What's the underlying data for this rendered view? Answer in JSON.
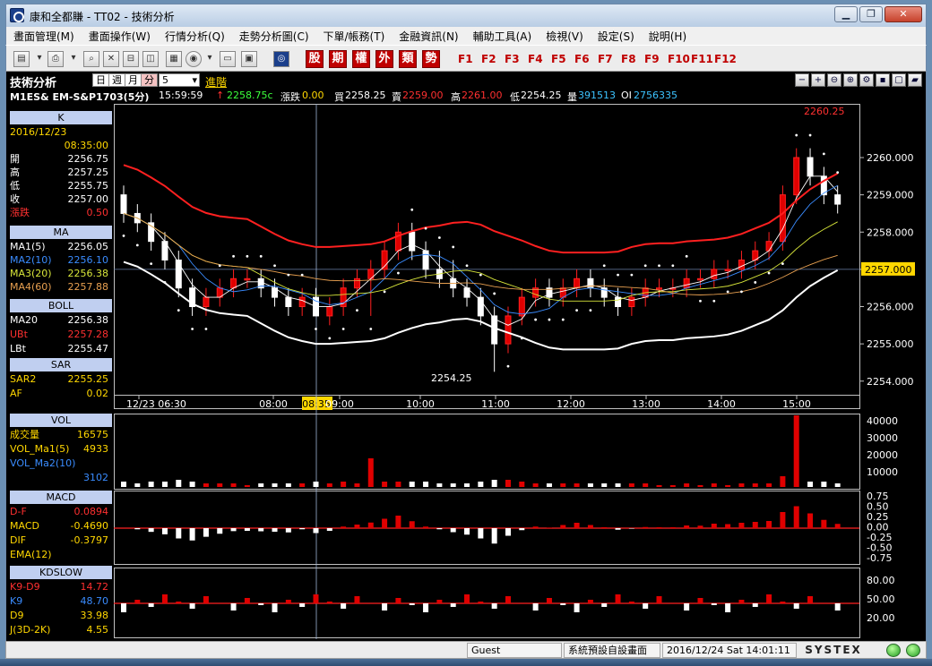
{
  "window": {
    "title": "康和全都賺 - TT02 - 技術分析",
    "min_icon": "minimize-icon",
    "max_icon": "maximize-icon",
    "close_icon": "close-icon"
  },
  "menu": [
    "畫面管理(M)",
    "畫面操作(W)",
    "行情分析(Q)",
    "走勢分析圖(C)",
    "下單/帳務(T)",
    "金融資訊(N)",
    "輔助工具(A)",
    "檢視(V)",
    "設定(S)",
    "說明(H)"
  ],
  "toolbar": {
    "red_buttons": [
      "股",
      "期",
      "權",
      "外",
      "類",
      "勢"
    ],
    "fkeys": [
      "F1",
      "F2",
      "F3",
      "F4",
      "F5",
      "F6",
      "F7",
      "F8",
      "F9",
      "F10",
      "F11",
      "F12"
    ]
  },
  "chart_header": {
    "title": "技術分析",
    "periods": [
      "日",
      "週",
      "月",
      "分"
    ],
    "selected_period": "分",
    "interval": "5",
    "advanced": "進階"
  },
  "quote": {
    "symbol": "M1ES&  EM-S&P1703(5分)",
    "time": "15:59:59",
    "arrow": "↑",
    "last": "2258.75c",
    "change_label": "漲跌",
    "change": "0.00",
    "bid_label": "買",
    "bid": "2258.25",
    "ask_label": "賣",
    "ask": "2259.00",
    "high_label": "高",
    "high": "2261.00",
    "low_label": "低",
    "low": "2254.25",
    "vol_label": "量",
    "vol": "391513",
    "oi_label": "OI",
    "oi": "2756335"
  },
  "panel": {
    "k": {
      "head": "K",
      "date": "2016/12/23",
      "time": "08:35:00",
      "rows": [
        {
          "label": "開",
          "value": "2256.75",
          "color": "#ffffff"
        },
        {
          "label": "高",
          "value": "2257.25",
          "color": "#ffffff"
        },
        {
          "label": "低",
          "value": "2255.75",
          "color": "#ffffff"
        },
        {
          "label": "收",
          "value": "2257.00",
          "color": "#ffffff"
        },
        {
          "label": "漲跌",
          "value": "0.50",
          "color": "#ff3030"
        }
      ]
    },
    "ma": {
      "head": "MA",
      "rows": [
        {
          "label": "MA1(5)",
          "value": "2256.05",
          "color": "#ffffff"
        },
        {
          "label": "MA2(10)",
          "value": "2256.10",
          "color": "#3a8cff"
        },
        {
          "label": "MA3(20)",
          "value": "2256.38",
          "color": "#d8e63a"
        },
        {
          "label": "MA4(60)",
          "value": "2257.88",
          "color": "#e8a050"
        }
      ]
    },
    "boll": {
      "head": "BOLL",
      "rows": [
        {
          "label": "MA20",
          "value": "2256.38",
          "color": "#ffffff"
        },
        {
          "label": "UBt",
          "value": "2257.28",
          "color": "#ff3030"
        },
        {
          "label": "LBt",
          "value": "2255.47",
          "color": "#ffffff"
        }
      ]
    },
    "sar": {
      "head": "SAR",
      "rows": [
        {
          "label": "SAR2",
          "value": "2255.25",
          "color": "#ffd700"
        },
        {
          "label": "AF",
          "value": "0.02",
          "color": "#ffd700"
        }
      ]
    },
    "vol": {
      "head": "VOL",
      "rows": [
        {
          "label": "成交量",
          "value": "16575",
          "color": "#ffd700"
        },
        {
          "label": "VOL_Ma1(5)",
          "value": "4933",
          "color": "#ffd700"
        },
        {
          "label": "VOL_Ma2(10)",
          "value": "",
          "color": "#3a8cff"
        },
        {
          "label": "",
          "value": "3102",
          "color": "#3a8cff"
        }
      ]
    },
    "macd": {
      "head": "MACD",
      "rows": [
        {
          "label": "D-F",
          "value": "0.0894",
          "color": "#ff3030"
        },
        {
          "label": "MACD",
          "value": "-0.4690",
          "color": "#ffd700"
        },
        {
          "label": "DIF",
          "value": "-0.3797",
          "color": "#ffd700"
        },
        {
          "label": "EMA(12)",
          "value": "",
          "color": "#ffd700"
        }
      ]
    },
    "kd": {
      "head": "KDSLOW",
      "rows": [
        {
          "label": "K9-D9",
          "value": "14.72",
          "color": "#ff3030"
        },
        {
          "label": "K9",
          "value": "48.70",
          "color": "#3a8cff"
        },
        {
          "label": "D9",
          "value": "33.98",
          "color": "#ffd700"
        },
        {
          "label": "J(3D-2K)",
          "value": "4.55",
          "color": "#ffd700"
        }
      ]
    }
  },
  "chart_data": {
    "type": "candlestick",
    "price_axis": {
      "ticks": [
        "2260.000",
        "2259.000",
        "2258.000",
        "2257.000",
        "2256.000",
        "2255.000",
        "2254.000"
      ],
      "ylim": [
        2253.85,
        2261.25
      ]
    },
    "time_axis": {
      "ticks": [
        "12/23 06:30",
        "08:00",
        "08:35",
        "09:00",
        "10:00",
        "11:00",
        "12:00",
        "13:00",
        "14:00",
        "15:00"
      ]
    },
    "last_price_marker": "2257.000",
    "cursor_time": "08:35",
    "annotations": {
      "high": "2260.25",
      "low": "2254.25"
    },
    "candles": [
      [
        2259.0,
        2259.25,
        2258.25,
        2258.5
      ],
      [
        2258.5,
        2258.75,
        2258.0,
        2258.25
      ],
      [
        2258.25,
        2258.5,
        2257.5,
        2257.75
      ],
      [
        2257.75,
        2258.0,
        2257.0,
        2257.25
      ],
      [
        2257.25,
        2257.5,
        2256.25,
        2256.5
      ],
      [
        2256.5,
        2256.75,
        2255.75,
        2256.0
      ],
      [
        2256.0,
        2256.5,
        2255.75,
        2256.25
      ],
      [
        2256.25,
        2256.75,
        2256.0,
        2256.5
      ],
      [
        2256.5,
        2257.0,
        2256.25,
        2256.75
      ],
      [
        2256.75,
        2257.0,
        2256.5,
        2256.75
      ],
      [
        2256.75,
        2257.0,
        2256.25,
        2256.5
      ],
      [
        2256.5,
        2256.75,
        2256.0,
        2256.25
      ],
      [
        2256.25,
        2256.5,
        2255.75,
        2256.0
      ],
      [
        2256.0,
        2256.5,
        2255.75,
        2256.25
      ],
      [
        2256.25,
        2256.5,
        2255.75,
        2255.75
      ],
      [
        2255.75,
        2256.25,
        2255.5,
        2256.0
      ],
      [
        2256.0,
        2256.75,
        2255.75,
        2256.5
      ],
      [
        2256.5,
        2257.0,
        2256.25,
        2256.75
      ],
      [
        2256.75,
        2257.25,
        2255.75,
        2257.0
      ],
      [
        2257.0,
        2257.75,
        2256.75,
        2257.5
      ],
      [
        2257.5,
        2258.25,
        2257.25,
        2258.0
      ],
      [
        2258.0,
        2258.25,
        2257.25,
        2257.5
      ],
      [
        2257.5,
        2257.75,
        2256.75,
        2257.0
      ],
      [
        2257.0,
        2257.5,
        2256.5,
        2256.75
      ],
      [
        2256.75,
        2257.25,
        2256.25,
        2256.5
      ],
      [
        2256.5,
        2256.75,
        2256.0,
        2256.25
      ],
      [
        2256.25,
        2256.5,
        2255.5,
        2255.75
      ],
      [
        2255.75,
        2256.0,
        2254.25,
        2255.0
      ],
      [
        2255.0,
        2256.0,
        2254.75,
        2255.75
      ],
      [
        2255.75,
        2256.5,
        2255.5,
        2256.25
      ],
      [
        2256.25,
        2256.75,
        2256.0,
        2256.5
      ],
      [
        2256.5,
        2256.75,
        2256.0,
        2256.25
      ],
      [
        2256.25,
        2256.75,
        2256.0,
        2256.5
      ],
      [
        2256.5,
        2257.0,
        2256.25,
        2256.75
      ],
      [
        2256.75,
        2257.0,
        2256.25,
        2256.5
      ],
      [
        2256.5,
        2256.75,
        2256.0,
        2256.25
      ],
      [
        2256.25,
        2256.5,
        2255.75,
        2256.0
      ],
      [
        2256.0,
        2256.5,
        2255.75,
        2256.25
      ],
      [
        2256.25,
        2256.75,
        2256.0,
        2256.5
      ],
      [
        2256.5,
        2256.75,
        2256.25,
        2256.5
      ],
      [
        2256.5,
        2256.75,
        2256.25,
        2256.5
      ],
      [
        2256.5,
        2257.0,
        2256.25,
        2256.75
      ],
      [
        2256.75,
        2257.0,
        2256.5,
        2256.75
      ],
      [
        2256.75,
        2257.25,
        2256.5,
        2257.0
      ],
      [
        2257.0,
        2257.25,
        2256.75,
        2257.0
      ],
      [
        2257.0,
        2257.5,
        2256.75,
        2257.25
      ],
      [
        2257.25,
        2257.75,
        2257.0,
        2257.5
      ],
      [
        2257.5,
        2258.0,
        2257.25,
        2257.75
      ],
      [
        2257.75,
        2259.25,
        2257.5,
        2259.0
      ],
      [
        2259.0,
        2260.25,
        2258.75,
        2260.0
      ],
      [
        2260.0,
        2260.25,
        2259.25,
        2259.5
      ],
      [
        2259.5,
        2259.75,
        2258.75,
        2259.0
      ],
      [
        2259.0,
        2259.25,
        2258.5,
        2258.75
      ]
    ],
    "volume_axis": {
      "ticks": [
        "40000",
        "30000",
        "20000",
        "10000"
      ]
    },
    "macd_axis": {
      "ticks": [
        "0.75",
        "0.50",
        "0.25",
        "0.00",
        "-0.25",
        "-0.50",
        "-0.75"
      ]
    },
    "kd_axis": {
      "ticks": [
        "80.00",
        "50.00",
        "20.00"
      ]
    }
  },
  "status": {
    "user": "Guest",
    "screen": "系統預設自設畫面",
    "datetime": "2016/12/24 Sat 14:01:11",
    "brand": "SYSTEX"
  }
}
